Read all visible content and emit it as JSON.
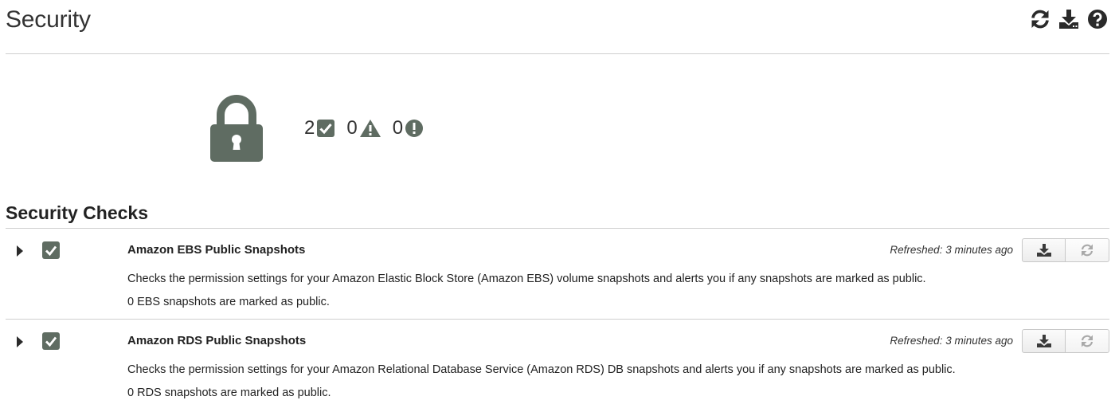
{
  "header": {
    "title": "Security",
    "actions": [
      {
        "name": "refresh-all",
        "icon": "refresh-icon"
      },
      {
        "name": "download-all",
        "icon": "download-icon"
      },
      {
        "name": "help",
        "icon": "help-icon"
      }
    ]
  },
  "summary": {
    "icon": "lock-icon",
    "ok_count": "2",
    "warning_count": "0",
    "error_count": "0"
  },
  "section": {
    "title": "Security Checks"
  },
  "checks": [
    {
      "status": "ok",
      "name": "Amazon EBS Public Snapshots",
      "refreshed": "Refreshed: 3 minutes ago",
      "description": "Checks the permission settings for your Amazon Elastic Block Store (Amazon EBS) volume snapshots and alerts you if any snapshots are marked as public.",
      "result": "0 EBS snapshots are marked as public."
    },
    {
      "status": "ok",
      "name": "Amazon RDS Public Snapshots",
      "refreshed": "Refreshed: 3 minutes ago",
      "description": "Checks the permission settings for your Amazon Relational Database Service (Amazon RDS) DB snapshots and alerts you if any snapshots are marked as public.",
      "result": "0 RDS snapshots are marked as public."
    }
  ],
  "colors": {
    "icon_gray": "#5f6c62",
    "text": "#222222",
    "rule": "#cfcfcf"
  }
}
